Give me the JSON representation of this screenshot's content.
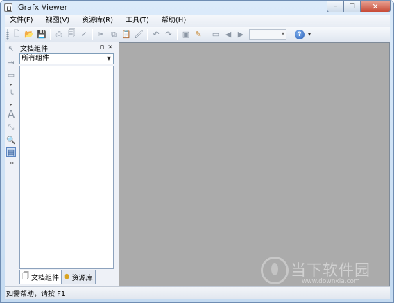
{
  "window": {
    "title": "iGrafx Viewer",
    "controls": {
      "minimize": "‒",
      "maximize": "□",
      "close": "✕"
    }
  },
  "menu": [
    "文件(F)",
    "视图(V)",
    "资源库(R)",
    "工具(T)",
    "帮助(H)"
  ],
  "toolbar": {
    "icons": [
      "new-icon",
      "open-icon",
      "save-icon",
      "print-icon",
      "print-preview-icon",
      "spell-check-icon",
      "cut-icon",
      "copy-icon",
      "paste-icon",
      "format-painter-icon",
      "undo-icon",
      "redo-icon",
      "stamp-icon",
      "pencil-icon",
      "screen-icon",
      "back-icon",
      "forward-icon",
      "zoom-combo",
      "help-icon"
    ],
    "zoom_value": "",
    "help_glyph": "?"
  },
  "toolstrip": [
    "pointer-tool-icon",
    "connector-tool-icon",
    "rectangle-tool-icon",
    "line-tool-icon",
    "text-tool-icon",
    "stretch-tool-icon",
    "zoom-tool-icon",
    "page-tool-icon"
  ],
  "panel": {
    "title": "文档组件",
    "pin_glyph": "⊓",
    "close_glyph": "✕",
    "filter_value": "所有组件",
    "tabs": [
      {
        "label": "文档组件",
        "icon": "document-components-icon"
      },
      {
        "label": "资源库",
        "icon": "library-icon"
      }
    ]
  },
  "statusbar": {
    "text": "如需帮助，请按 F1"
  },
  "watermark": {
    "text": "当下软件园",
    "url": "www.downxia.com"
  },
  "colors": {
    "canvas": "#ababab",
    "title_gradient_top": "#dcebfa",
    "close_button": "#c74a36"
  }
}
